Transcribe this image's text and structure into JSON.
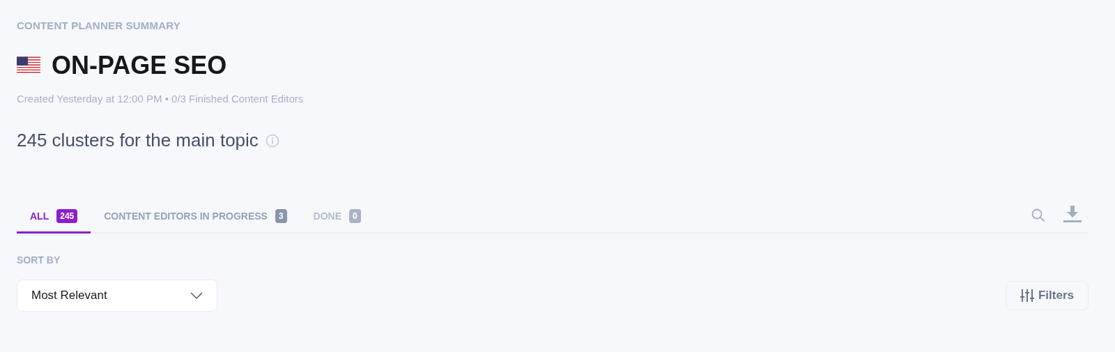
{
  "eyebrow": "CONTENT PLANNER SUMMARY",
  "title": "ON-PAGE SEO",
  "meta": "Created Yesterday at 12:00 PM • 0/3 Finished Content Editors",
  "summary": "245 clusters for the main topic",
  "tabs": [
    {
      "label": "ALL",
      "count": "245",
      "selected": true,
      "disabled": false
    },
    {
      "label": "CONTENT EDITORS IN PROGRESS",
      "count": "3",
      "selected": false,
      "disabled": false
    },
    {
      "label": "DONE",
      "count": "0",
      "selected": false,
      "disabled": true
    }
  ],
  "sort": {
    "label": "SORT BY",
    "value": "Most Relevant"
  },
  "filters_button": "Filters"
}
